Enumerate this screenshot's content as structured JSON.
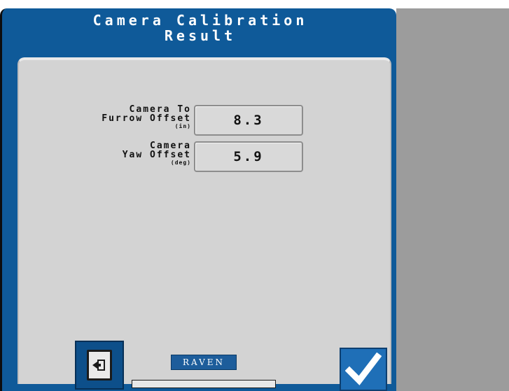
{
  "title": {
    "line1": "Camera Calibration",
    "line2": "Result"
  },
  "fields": [
    {
      "label_line1": "Camera To",
      "label_line2": "Furrow Offset",
      "unit": "(in)",
      "value": "8.3"
    },
    {
      "label_line1": "Camera",
      "label_line2": "Yaw Offset",
      "unit": "(deg)",
      "value": "5.9"
    }
  ],
  "footer": {
    "logo_text": "RAVEN",
    "progress": 0
  },
  "icons": {
    "exit": "exit-door-icon",
    "confirm": "checkmark-icon"
  },
  "colors": {
    "panel_blue": "#0f5a99",
    "content_gray": "#d3d3d3",
    "right_gray": "#9c9c9c",
    "confirm_blue": "#1f6fb7"
  }
}
